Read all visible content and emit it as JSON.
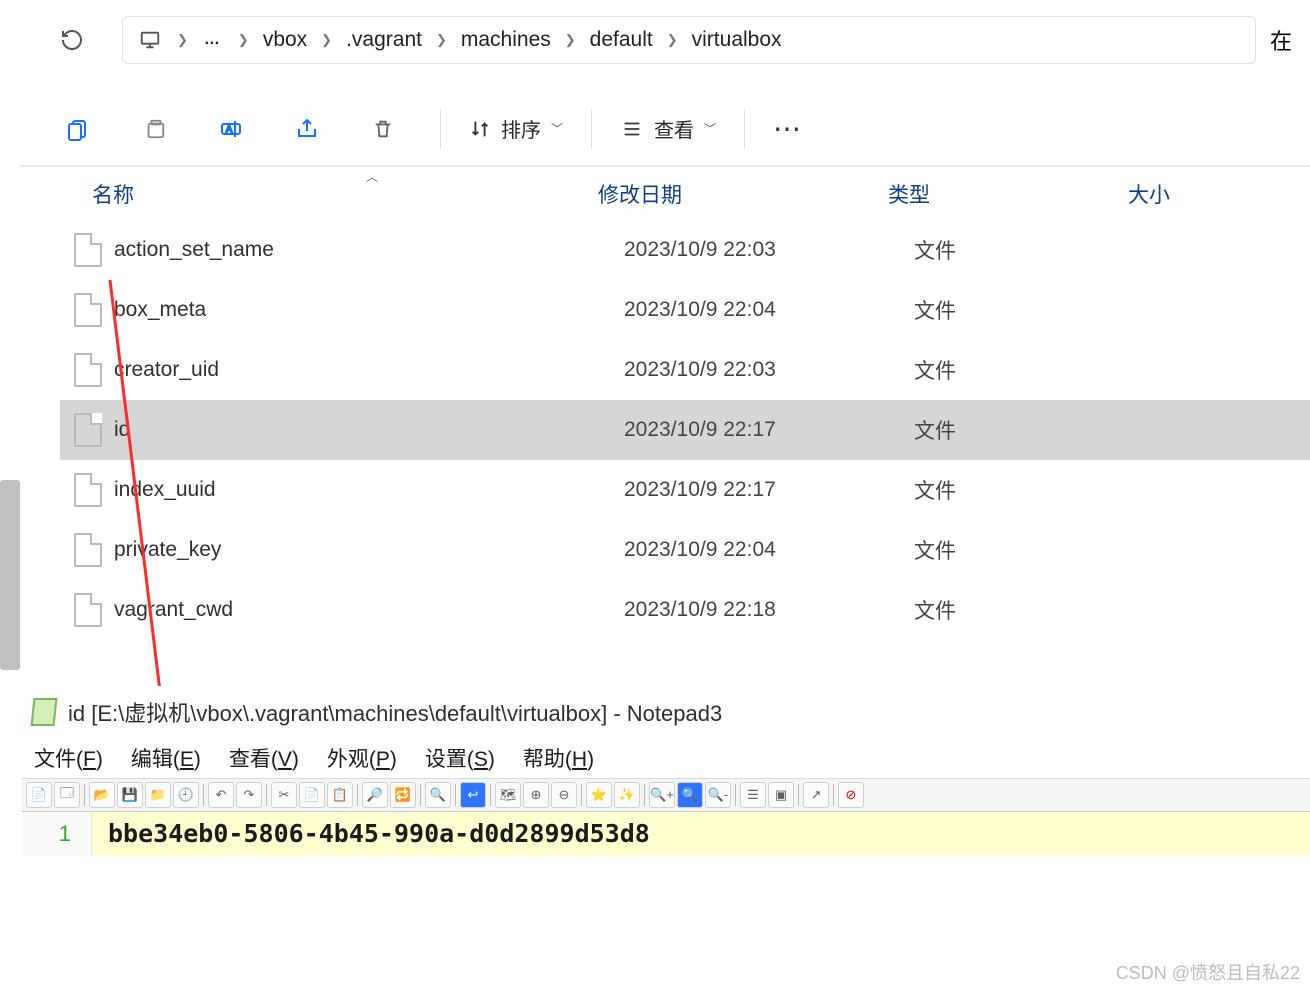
{
  "breadcrumb": {
    "items": [
      "vbox",
      ".vagrant",
      "machines",
      "default",
      "virtualbox"
    ],
    "right_stub": "在"
  },
  "toolbar": {
    "sort_label": "排序",
    "view_label": "查看"
  },
  "columns": {
    "name": "名称",
    "modified": "修改日期",
    "type": "类型",
    "size": "大小"
  },
  "files": [
    {
      "name": "action_set_name",
      "modified": "2023/10/9 22:03",
      "type": "文件",
      "selected": false
    },
    {
      "name": "box_meta",
      "modified": "2023/10/9 22:04",
      "type": "文件",
      "selected": false
    },
    {
      "name": "creator_uid",
      "modified": "2023/10/9 22:03",
      "type": "文件",
      "selected": false
    },
    {
      "name": "id",
      "modified": "2023/10/9 22:17",
      "type": "文件",
      "selected": true
    },
    {
      "name": "index_uuid",
      "modified": "2023/10/9 22:17",
      "type": "文件",
      "selected": false
    },
    {
      "name": "private_key",
      "modified": "2023/10/9 22:04",
      "type": "文件",
      "selected": false
    },
    {
      "name": "vagrant_cwd",
      "modified": "2023/10/9 22:18",
      "type": "文件",
      "selected": false
    }
  ],
  "notepad": {
    "title": "id [E:\\虚拟机\\vbox\\.vagrant\\machines\\default\\virtualbox] - Notepad3",
    "menus": {
      "file": "文件(F)",
      "edit": "编辑(E)",
      "view": "查看(V)",
      "appearance": "外观(P)",
      "settings": "设置(S)",
      "help": "帮助(H)"
    },
    "line_no": "1",
    "content": "bbe34eb0-5806-4b45-990a-d0d2899d53d8"
  },
  "watermark": "CSDN @愤怒且自私22"
}
